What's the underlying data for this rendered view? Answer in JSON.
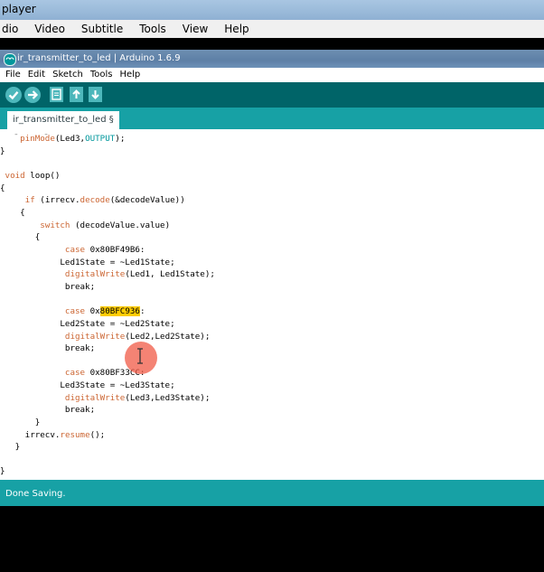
{
  "player": {
    "title": "player",
    "menu": [
      "dio",
      "Video",
      "Subtitle",
      "Tools",
      "View",
      "Help"
    ]
  },
  "arduino": {
    "title": "ir_transmitter_to_led | Arduino 1.6.9",
    "menu": [
      "File",
      "Edit",
      "Sketch",
      "Tools",
      "Help"
    ],
    "toolbar": {
      "verify_icon": "checkmark-icon",
      "upload_icon": "arrow-right-icon",
      "new_icon": "document-icon",
      "open_icon": "arrow-up-icon",
      "save_icon": "arrow-down-icon"
    },
    "tab_label": "ir_transmitter_to_led §",
    "status": "Done Saving.",
    "code": {
      "l0": "  pinMode(Led3,OUTPUT);",
      "l1": "}",
      "l2": "",
      "l3": "void loop()",
      "l4": "{",
      "l5": "    if (irrecv.decode(&decodeValue))",
      "l6": "    {",
      "l7": "       switch (decodeValue.value)",
      "l8": "       {",
      "l9": "            case 0x80BF49B6:",
      "l10": "            Led1State = ~Led1State;",
      "l11": "            digitalWrite(Led1, Led1State);",
      "l12": "            break;",
      "l13": "",
      "l14": "            case 0x80BFC936:",
      "l15": "            Led2State = ~Led2State;",
      "l16": "            digitalWrite(Led2,Led2State);",
      "l17": "            break;",
      "l18": "",
      "l19": "            case 0x80BF33CC:",
      "l20": "            Led3State = ~Led3State;",
      "l21": "            digitalWrite(Led3,Led3State);",
      "l22": "            break;",
      "l23": "       }",
      "l24": "    irrecv.resume();",
      "l25": "   }",
      "l26": "",
      "l27": "}"
    },
    "tokens": {
      "pinmode": "pinMode",
      "pinmode_args": "(Led3,",
      "output": "OUTPUT",
      "pinmode_end": ");",
      "void": "void",
      "loop": " loop()",
      "if": "if",
      "if_a": " (irrecv.",
      "decode": "decode",
      "if_b": "(&decodeValue))",
      "switch": "switch",
      "switch_b": " (decodeValue.value)",
      "case": "case",
      "c1": " 0x80BF49B6:",
      "c2_pre": " 0x",
      "c2_hl": "80BFC936",
      "c2_post": ":",
      "c3": " 0x80BF33CC:",
      "dw": "digitalWrite",
      "dw1": "(Led1, Led1State);",
      "dw2": "(Led2,Led2State);",
      "dw3": "(Led3,Led3State);",
      "break": "break;",
      "irrecv": "irrecv.",
      "resume": "resume",
      "resume_end": "();"
    }
  }
}
